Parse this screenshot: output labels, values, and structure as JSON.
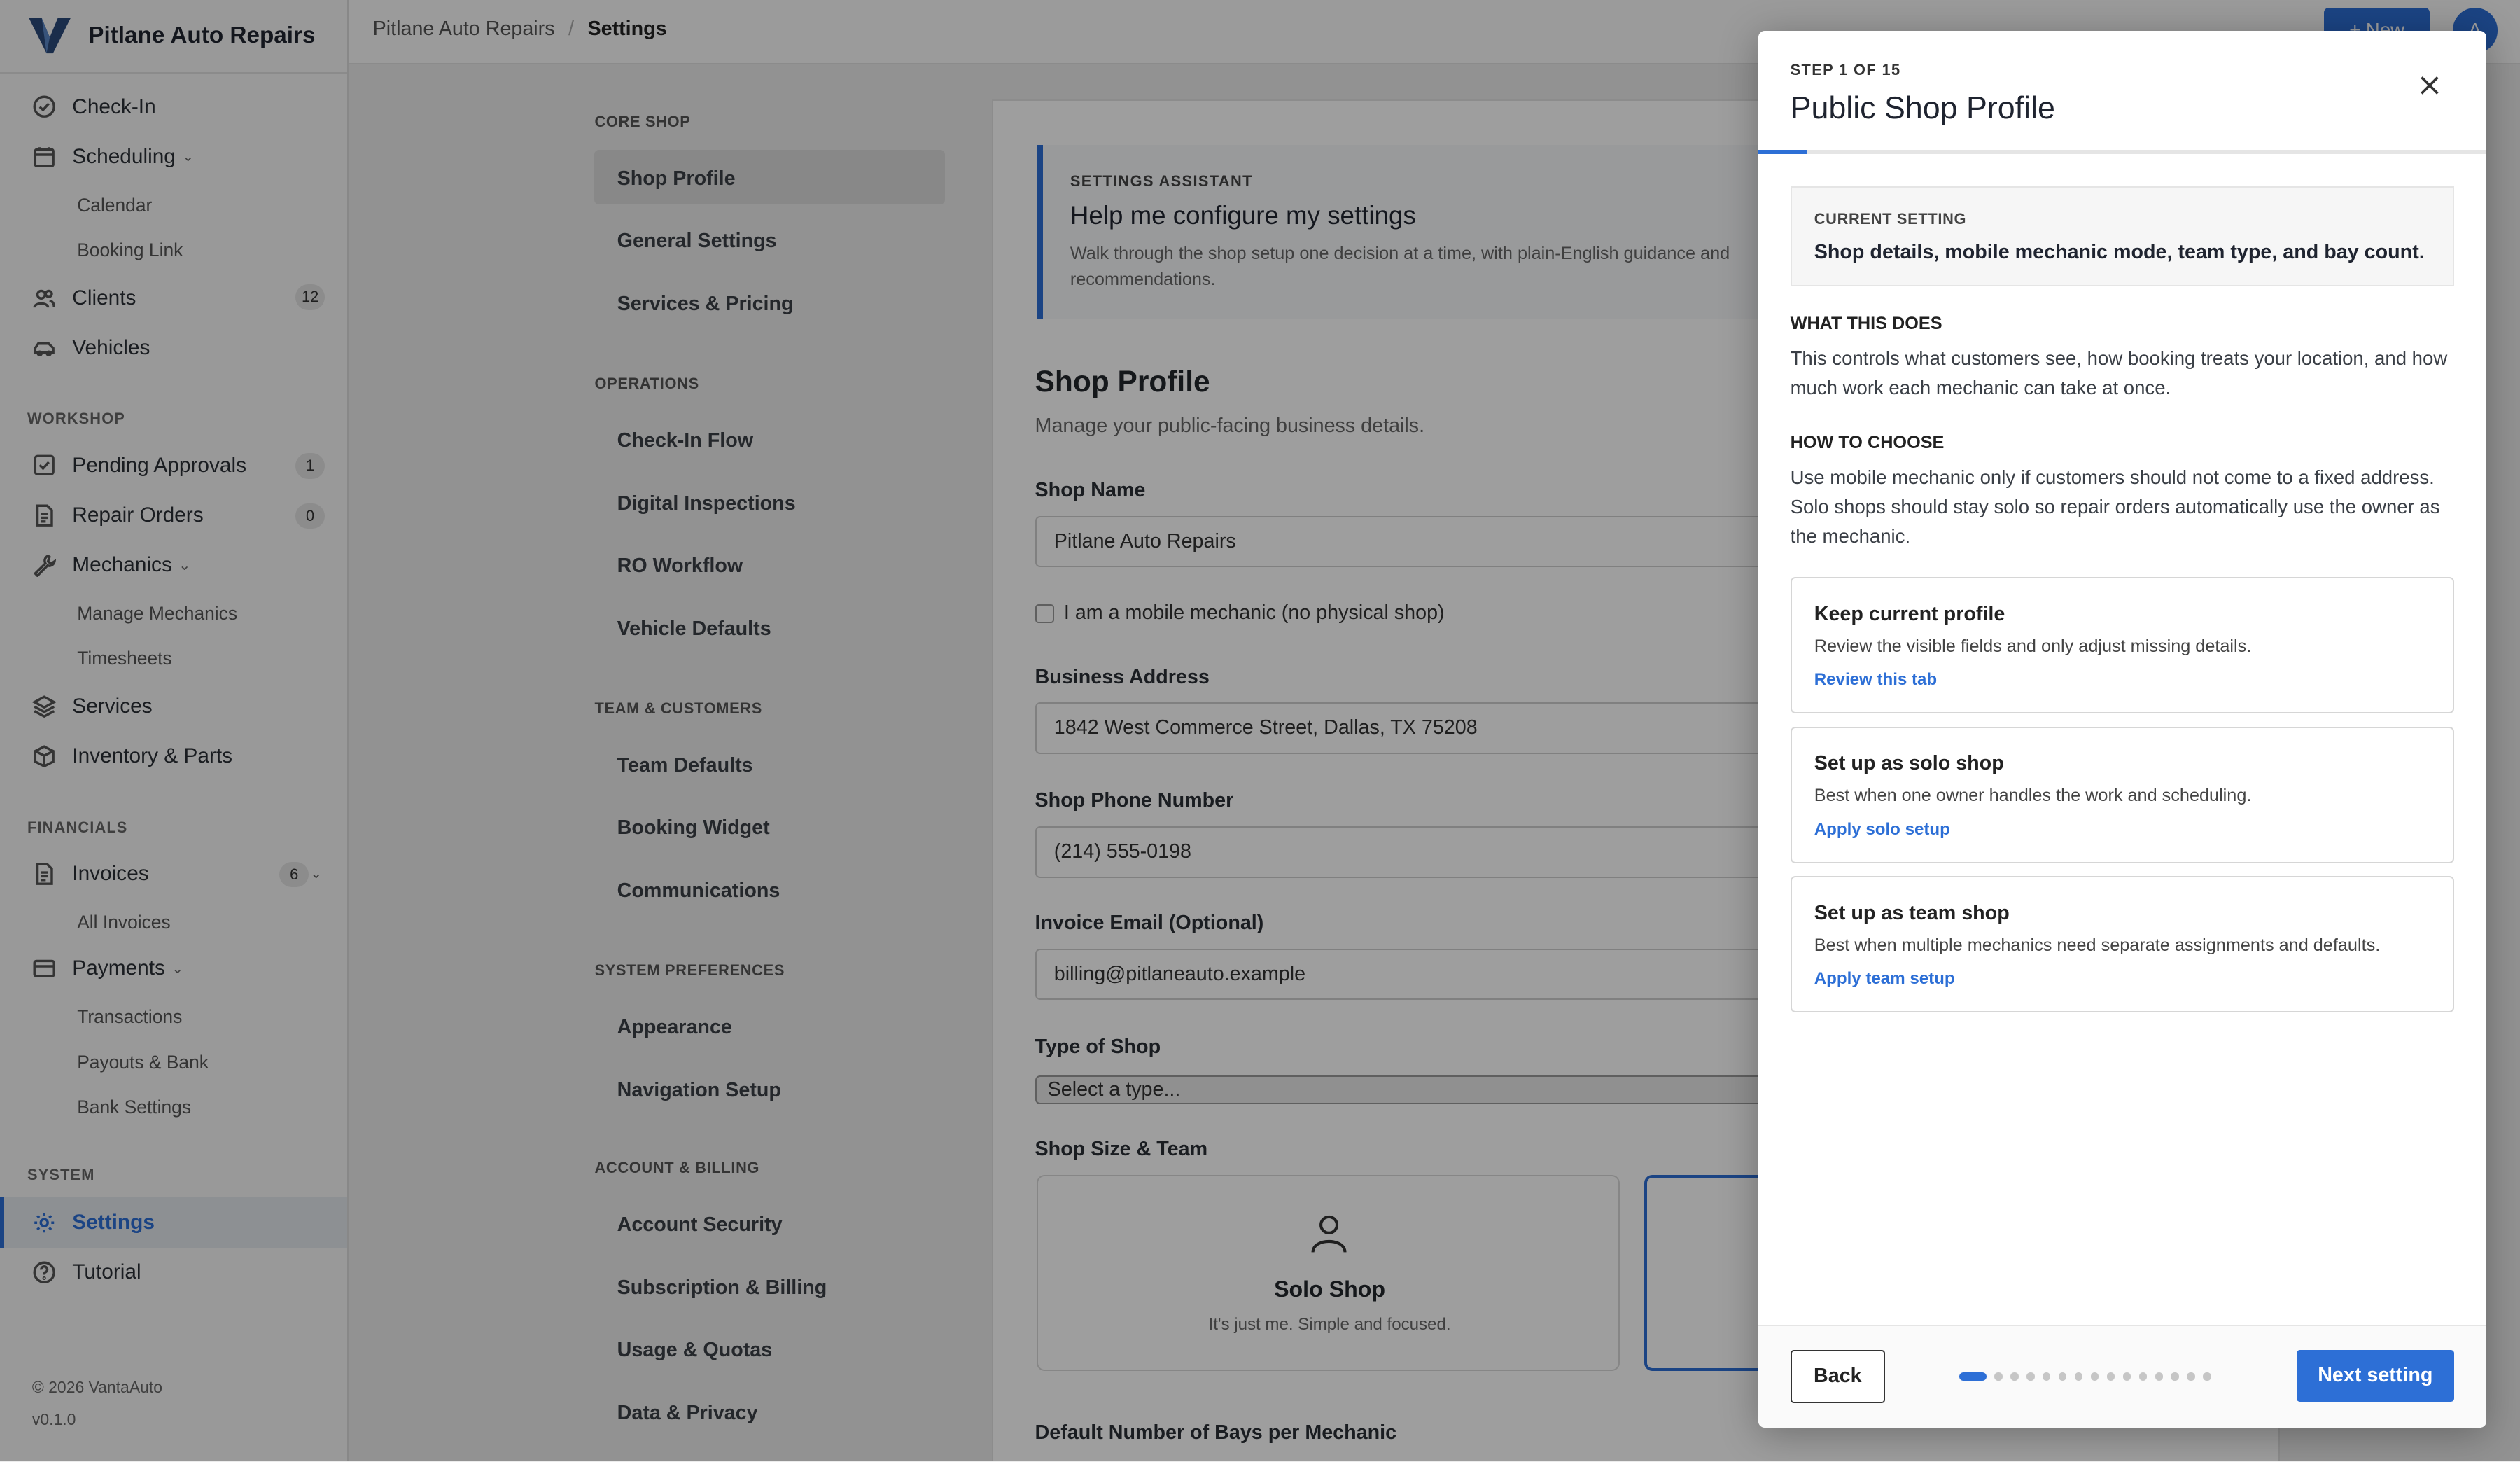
{
  "app": {
    "name": "Pitlane Auto Repairs"
  },
  "sidebar": {
    "items": [
      {
        "label": "Check-In",
        "icon": "check-circle-icon"
      },
      {
        "label": "Scheduling",
        "icon": "calendar-icon"
      },
      {
        "label": "Calendar"
      },
      {
        "label": "Booking Link"
      },
      {
        "label": "Clients",
        "icon": "users-icon",
        "badge": "12"
      },
      {
        "label": "Vehicles",
        "icon": "car-icon"
      }
    ],
    "workshop_head": "WORKSHOP",
    "workshop": [
      {
        "label": "Pending Approvals",
        "badge": "1"
      },
      {
        "label": "Repair Orders",
        "badge": "0"
      },
      {
        "label": "Mechanics"
      },
      {
        "label": "Manage Mechanics"
      },
      {
        "label": "Timesheets"
      },
      {
        "label": "Services"
      },
      {
        "label": "Inventory & Parts"
      }
    ],
    "financials_head": "FINANCIALS",
    "financials": [
      {
        "label": "Invoices",
        "badge": "6"
      },
      {
        "label": "All Invoices"
      },
      {
        "label": "Payments"
      },
      {
        "label": "Transactions"
      },
      {
        "label": "Payouts & Bank"
      },
      {
        "label": "Bank Settings"
      }
    ],
    "system_head": "SYSTEM",
    "system": [
      {
        "label": "Settings"
      },
      {
        "label": "Tutorial"
      }
    ],
    "copyright": "© 2026 VantaAuto",
    "version": "v0.1.0"
  },
  "topbar": {
    "crumb_root": "Pitlane Auto Repairs",
    "crumb_sep": "/",
    "crumb_current": "Settings",
    "new_label": "+ New",
    "avatar_initial": "A"
  },
  "settings_nav": {
    "core_head": "CORE SHOP",
    "core": [
      "Shop Profile",
      "General Settings",
      "Services & Pricing"
    ],
    "ops_head": "OPERATIONS",
    "ops": [
      "Check-In Flow",
      "Digital Inspections",
      "RO Workflow",
      "Vehicle Defaults"
    ],
    "team_head": "TEAM & CUSTOMERS",
    "team": [
      "Team Defaults",
      "Booking Widget",
      "Communications"
    ],
    "sys_head": "SYSTEM PREFERENCES",
    "sys": [
      "Appearance",
      "Navigation Setup"
    ],
    "acct_head": "ACCOUNT & BILLING",
    "acct": [
      "Account Security",
      "Subscription & Billing",
      "Usage & Quotas",
      "Data & Privacy"
    ]
  },
  "main": {
    "assistant_head": "SETTINGS ASSISTANT",
    "assistant_title": "Help me configure my settings",
    "assistant_body": "Walk through the shop setup one decision at a time, with plain-English guidance and recommendations.",
    "section_title": "Shop Profile",
    "section_sub": "Manage your public-facing business details.",
    "shop_name_label": "Shop Name",
    "shop_name_value": "Pitlane Auto Repairs",
    "mobile_label": "I am a mobile mechanic (no physical shop)",
    "address_label": "Business Address",
    "address_value": "1842 West Commerce Street, Dallas, TX 75208",
    "phone_label": "Shop Phone Number",
    "phone_value": "(214) 555-0198",
    "email_label": "Invoice Email (Optional)",
    "email_value": "billing@pitlaneauto.example",
    "type_label": "Type of Shop",
    "type_value": "Select a type...",
    "size_label": "Shop Size & Team",
    "solo_title": "Solo Shop",
    "solo_desc": "It's just me. Simple and focused.",
    "bays_label": "Default Number of Bays per Mechanic"
  },
  "wizard": {
    "step": "STEP 1 OF 15",
    "progress_fraction": 0.0667,
    "title": "Public Shop Profile",
    "current_head": "CURRENT SETTING",
    "current_value": "Shop details, mobile mechanic mode, team type, and bay count.",
    "what_head": "WHAT THIS DOES",
    "what_body": "This controls what customers see, how booking treats your location, and how much work each mechanic can take at once.",
    "how_head": "HOW TO CHOOSE",
    "how_body": "Use mobile mechanic only if customers should not come to a fixed address. Solo shops should stay solo so repair orders automatically use the owner as the mechanic.",
    "options": [
      {
        "title": "Keep current profile",
        "desc": "Review the visible fields and only adjust missing details.",
        "action": "Review this tab"
      },
      {
        "title": "Set up as solo shop",
        "desc": "Best when one owner handles the work and scheduling.",
        "action": "Apply solo setup"
      },
      {
        "title": "Set up as team shop",
        "desc": "Best when multiple mechanics need separate assignments and defaults.",
        "action": "Apply team setup"
      }
    ],
    "back_label": "Back",
    "next_label": "Next setting",
    "total_steps": 15,
    "current_step": 1
  },
  "colors": {
    "accent": "#2d6fd6"
  }
}
